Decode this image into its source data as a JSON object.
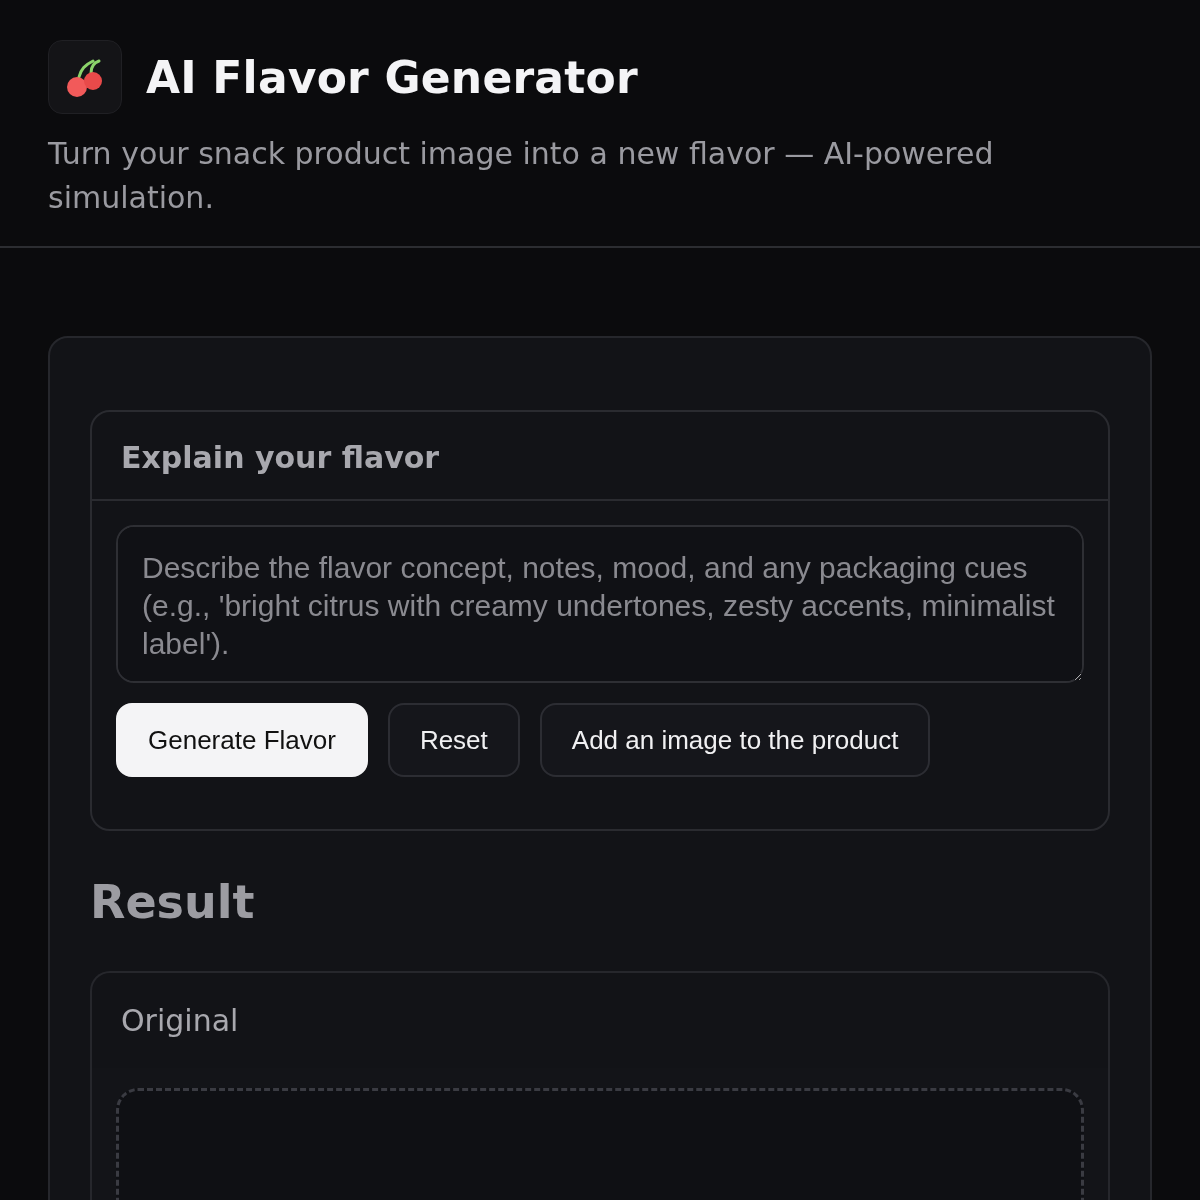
{
  "header": {
    "title": "AI Flavor Generator",
    "subtitle": "Turn your snack product image into a new flavor — AI-powered simulation."
  },
  "flavor_panel": {
    "title": "Explain your flavor",
    "placeholder": "Describe the flavor concept, notes, mood, and any packaging cues (e.g., 'bright citrus with creamy undertones, zesty accents, minimalist label').",
    "buttons": [
      {
        "label": "Generate Flavor",
        "kind": "primary"
      },
      {
        "label": "Reset",
        "kind": "secondary"
      },
      {
        "label": "Add an image to the product",
        "kind": "secondary"
      }
    ]
  },
  "result": {
    "title": "Result",
    "original": {
      "title": "Original"
    }
  }
}
